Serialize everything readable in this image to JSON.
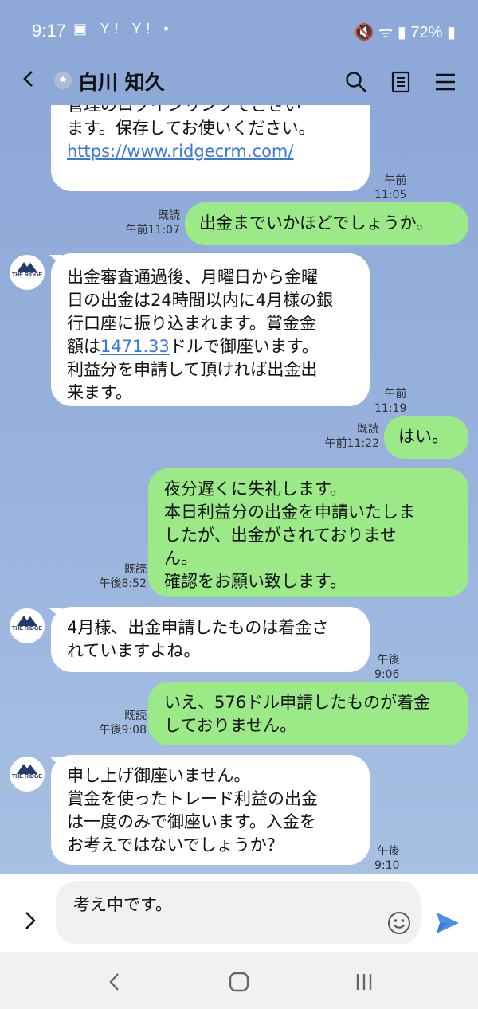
{
  "status": {
    "time": "9:17",
    "left_icons": "▣ Y! Y! •",
    "right_icons": "🔇 ᯤ ▮ 72% ▮"
  },
  "header": {
    "title": "白川 知久"
  },
  "messages": [
    {
      "dir": "in",
      "avatar": false,
      "text_before": "管理のログインリンクでござい\nます。保存してお使いください。\n",
      "link": "https://www.ridgecrm.com/",
      "text_after": "",
      "read": "",
      "time": "午前11:05"
    },
    {
      "dir": "out",
      "text": "出金までいかほどでしょうか。",
      "read": "既読",
      "time": "午前11:07"
    },
    {
      "dir": "in",
      "avatar": true,
      "text_before": "出金審査通過後、月曜日から金曜\n日の出金は24時間以内に4月様の銀\n行口座に振り込まれます。賞金金\n額は",
      "link": "1471.33",
      "text_after": "ドルで御座います。\n利益分を申請して頂ければ出金出\n来ます。",
      "read": "",
      "time": "午前11:19"
    },
    {
      "dir": "out",
      "text": "はい。",
      "read": "既読",
      "time": "午前11:22"
    },
    {
      "dir": "out",
      "text": "夜分遅くに失礼します。\n本日利益分の出金を申請いたしま\nしたが、出金がされておりませ\nん。\n確認をお願い致します。",
      "read": "既読",
      "time": "午後8:52"
    },
    {
      "dir": "in",
      "avatar": true,
      "text_before": "4月様、出金申請したものは着金さ\nれていますよね。",
      "link": "",
      "text_after": "",
      "read": "",
      "time": "午後9:06"
    },
    {
      "dir": "out",
      "text": "いえ、576ドル申請したものが着金\nしておりません。",
      "read": "既読",
      "time": "午後9:08"
    },
    {
      "dir": "in",
      "avatar": true,
      "text_before": "申し上げ御座いません。\n賞金を使ったトレード利益の出金\nは一度のみで御座います。入金を\nお考えではないでしょうか？",
      "link": "",
      "text_after": "",
      "read": "",
      "time": "午後9:10"
    }
  ],
  "avatar_label": "THE RIDGE",
  "input": {
    "value": "考え中です。"
  },
  "colors": {
    "background": "#8ea9d8",
    "outgoing": "#9bea87",
    "incoming": "#ffffff",
    "link": "#3a78d8",
    "send": "#4a8ee8"
  }
}
